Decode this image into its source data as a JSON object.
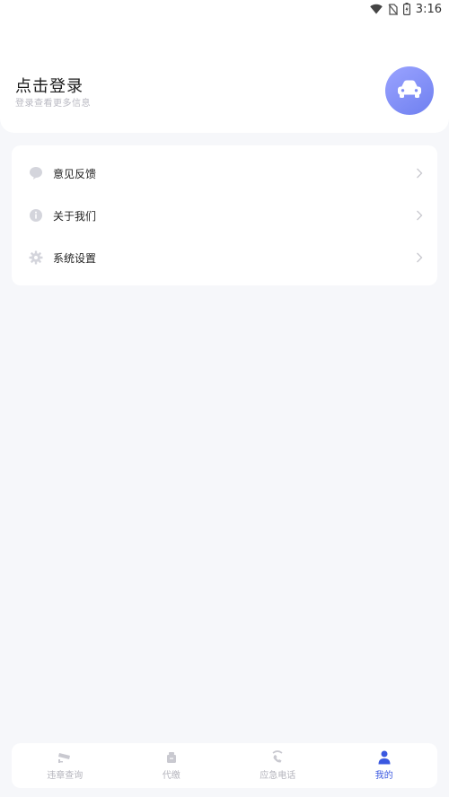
{
  "status_bar": {
    "time": "3:16"
  },
  "header": {
    "title": "点击登录",
    "subtitle": "登录查看更多信息",
    "avatar_icon": "car-icon"
  },
  "menu": {
    "items": [
      {
        "label": "意见反馈",
        "icon": "feedback-icon"
      },
      {
        "label": "关于我们",
        "icon": "info-icon"
      },
      {
        "label": "系统设置",
        "icon": "gear-icon"
      }
    ]
  },
  "tabs": [
    {
      "label": "违章查询",
      "icon": "camera-icon",
      "active": false
    },
    {
      "label": "代缴",
      "icon": "wallet-icon",
      "active": false
    },
    {
      "label": "应急电话",
      "icon": "phone-icon",
      "active": false
    },
    {
      "label": "我的",
      "icon": "user-icon",
      "active": true
    }
  ],
  "colors": {
    "accent": "#3a58e0",
    "background": "#f6f7fa",
    "avatar_gradient_start": "#9aa3ff",
    "avatar_gradient_end": "#6f80f0",
    "inactive": "#b4b4bc"
  }
}
